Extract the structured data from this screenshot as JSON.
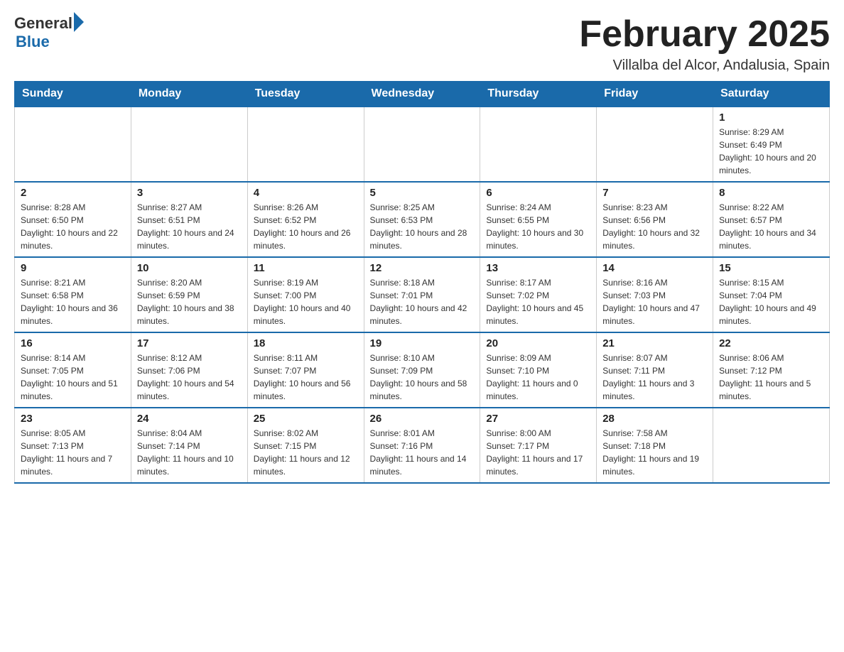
{
  "header": {
    "logo_general": "General",
    "logo_blue": "Blue",
    "main_title": "February 2025",
    "subtitle": "Villalba del Alcor, Andalusia, Spain"
  },
  "days_of_week": [
    "Sunday",
    "Monday",
    "Tuesday",
    "Wednesday",
    "Thursday",
    "Friday",
    "Saturday"
  ],
  "weeks": [
    [
      {
        "day": "",
        "info": ""
      },
      {
        "day": "",
        "info": ""
      },
      {
        "day": "",
        "info": ""
      },
      {
        "day": "",
        "info": ""
      },
      {
        "day": "",
        "info": ""
      },
      {
        "day": "",
        "info": ""
      },
      {
        "day": "1",
        "info": "Sunrise: 8:29 AM\nSunset: 6:49 PM\nDaylight: 10 hours and 20 minutes."
      }
    ],
    [
      {
        "day": "2",
        "info": "Sunrise: 8:28 AM\nSunset: 6:50 PM\nDaylight: 10 hours and 22 minutes."
      },
      {
        "day": "3",
        "info": "Sunrise: 8:27 AM\nSunset: 6:51 PM\nDaylight: 10 hours and 24 minutes."
      },
      {
        "day": "4",
        "info": "Sunrise: 8:26 AM\nSunset: 6:52 PM\nDaylight: 10 hours and 26 minutes."
      },
      {
        "day": "5",
        "info": "Sunrise: 8:25 AM\nSunset: 6:53 PM\nDaylight: 10 hours and 28 minutes."
      },
      {
        "day": "6",
        "info": "Sunrise: 8:24 AM\nSunset: 6:55 PM\nDaylight: 10 hours and 30 minutes."
      },
      {
        "day": "7",
        "info": "Sunrise: 8:23 AM\nSunset: 6:56 PM\nDaylight: 10 hours and 32 minutes."
      },
      {
        "day": "8",
        "info": "Sunrise: 8:22 AM\nSunset: 6:57 PM\nDaylight: 10 hours and 34 minutes."
      }
    ],
    [
      {
        "day": "9",
        "info": "Sunrise: 8:21 AM\nSunset: 6:58 PM\nDaylight: 10 hours and 36 minutes."
      },
      {
        "day": "10",
        "info": "Sunrise: 8:20 AM\nSunset: 6:59 PM\nDaylight: 10 hours and 38 minutes."
      },
      {
        "day": "11",
        "info": "Sunrise: 8:19 AM\nSunset: 7:00 PM\nDaylight: 10 hours and 40 minutes."
      },
      {
        "day": "12",
        "info": "Sunrise: 8:18 AM\nSunset: 7:01 PM\nDaylight: 10 hours and 42 minutes."
      },
      {
        "day": "13",
        "info": "Sunrise: 8:17 AM\nSunset: 7:02 PM\nDaylight: 10 hours and 45 minutes."
      },
      {
        "day": "14",
        "info": "Sunrise: 8:16 AM\nSunset: 7:03 PM\nDaylight: 10 hours and 47 minutes."
      },
      {
        "day": "15",
        "info": "Sunrise: 8:15 AM\nSunset: 7:04 PM\nDaylight: 10 hours and 49 minutes."
      }
    ],
    [
      {
        "day": "16",
        "info": "Sunrise: 8:14 AM\nSunset: 7:05 PM\nDaylight: 10 hours and 51 minutes."
      },
      {
        "day": "17",
        "info": "Sunrise: 8:12 AM\nSunset: 7:06 PM\nDaylight: 10 hours and 54 minutes."
      },
      {
        "day": "18",
        "info": "Sunrise: 8:11 AM\nSunset: 7:07 PM\nDaylight: 10 hours and 56 minutes."
      },
      {
        "day": "19",
        "info": "Sunrise: 8:10 AM\nSunset: 7:09 PM\nDaylight: 10 hours and 58 minutes."
      },
      {
        "day": "20",
        "info": "Sunrise: 8:09 AM\nSunset: 7:10 PM\nDaylight: 11 hours and 0 minutes."
      },
      {
        "day": "21",
        "info": "Sunrise: 8:07 AM\nSunset: 7:11 PM\nDaylight: 11 hours and 3 minutes."
      },
      {
        "day": "22",
        "info": "Sunrise: 8:06 AM\nSunset: 7:12 PM\nDaylight: 11 hours and 5 minutes."
      }
    ],
    [
      {
        "day": "23",
        "info": "Sunrise: 8:05 AM\nSunset: 7:13 PM\nDaylight: 11 hours and 7 minutes."
      },
      {
        "day": "24",
        "info": "Sunrise: 8:04 AM\nSunset: 7:14 PM\nDaylight: 11 hours and 10 minutes."
      },
      {
        "day": "25",
        "info": "Sunrise: 8:02 AM\nSunset: 7:15 PM\nDaylight: 11 hours and 12 minutes."
      },
      {
        "day": "26",
        "info": "Sunrise: 8:01 AM\nSunset: 7:16 PM\nDaylight: 11 hours and 14 minutes."
      },
      {
        "day": "27",
        "info": "Sunrise: 8:00 AM\nSunset: 7:17 PM\nDaylight: 11 hours and 17 minutes."
      },
      {
        "day": "28",
        "info": "Sunrise: 7:58 AM\nSunset: 7:18 PM\nDaylight: 11 hours and 19 minutes."
      },
      {
        "day": "",
        "info": ""
      }
    ]
  ]
}
